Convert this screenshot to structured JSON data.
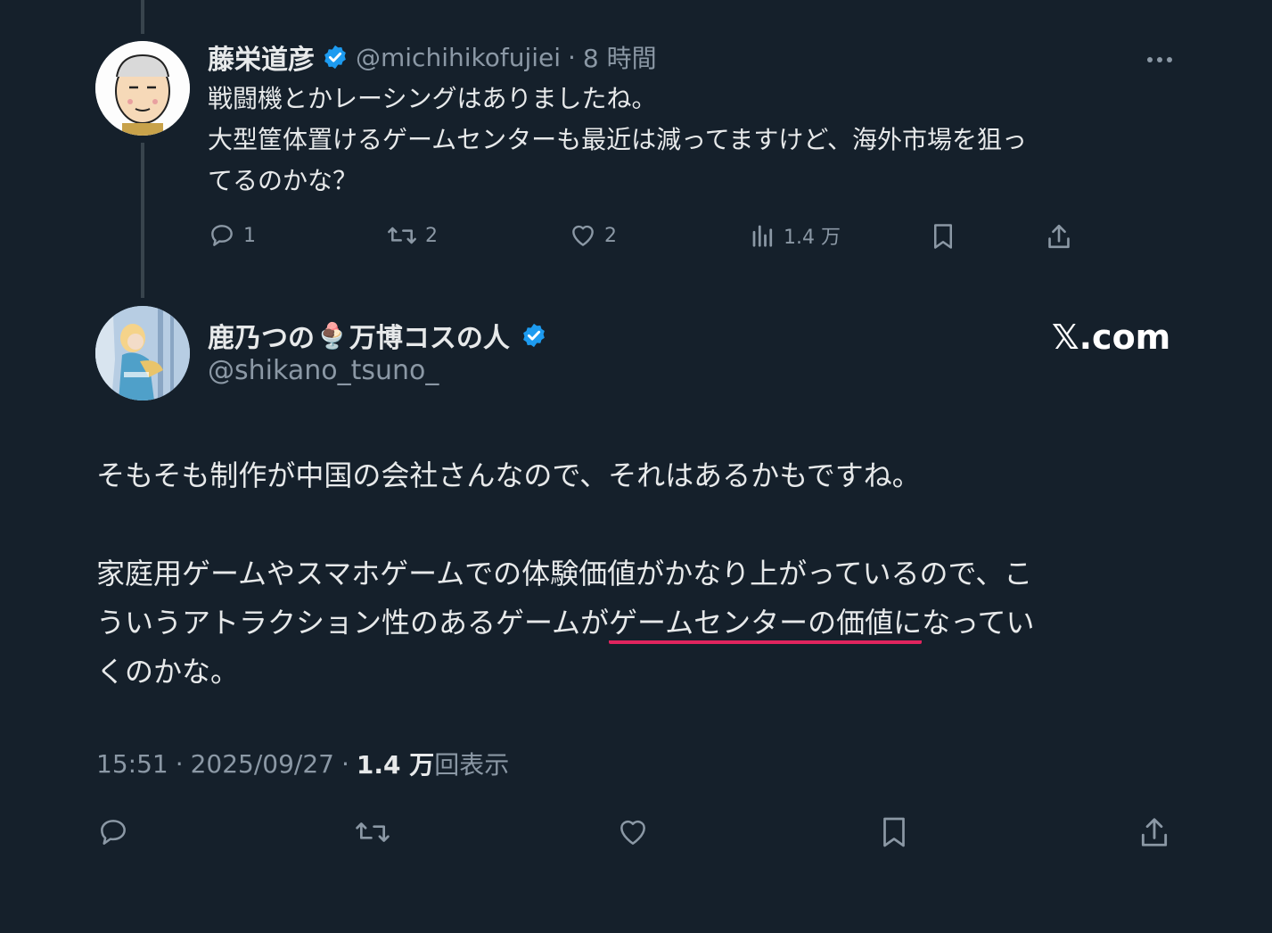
{
  "reply": {
    "author_name": "藤栄道彦",
    "handle": "@michihikofujiei",
    "separator": "·",
    "time_ago": "8 時間",
    "lines": [
      "戦闘機とかレーシングはありましたね。",
      "大型筐体置けるゲームセンターも最近は減ってますけど、海外市場を狙っ",
      "てるのかな？"
    ],
    "actions": {
      "reply_count": "1",
      "retweet_count": "2",
      "like_count": "2",
      "view_count": "1.4 万"
    }
  },
  "main": {
    "author_name_part1": "鹿乃つの",
    "author_emoji": "🍨",
    "author_name_part2": "万博コスの人",
    "handle": "@shikano_tsuno_",
    "site_label": "𝕏.com",
    "paragraph1": "そもそも制作が中国の会社さんなので、それはあるかもですね。",
    "paragraph2_line1": "家庭用ゲームやスマホゲームでの体験価値がかなり上がっているので、こ",
    "paragraph2_line2_pre": "ういうアトラクション性のあるゲームが",
    "paragraph2_line2_underlined": "ゲームセンターの価値に",
    "paragraph2_line2_post": "なってい",
    "paragraph2_line3": "くのかな。",
    "time": "15:51",
    "sep1": "·",
    "date": "2025/09/27",
    "sep2": "·",
    "views_count": "1.4 万",
    "views_label": "回表示"
  },
  "colors": {
    "background": "#15202b",
    "text": "#e7e9ea",
    "secondary": "#8b98a5",
    "verified": "#1d9bf0",
    "underline": "#e0245e",
    "thread_line": "#38444d"
  },
  "icons": [
    "more-icon",
    "verified-icon",
    "reply-icon",
    "retweet-icon",
    "like-icon",
    "views-icon",
    "bookmark-icon",
    "share-icon"
  ]
}
